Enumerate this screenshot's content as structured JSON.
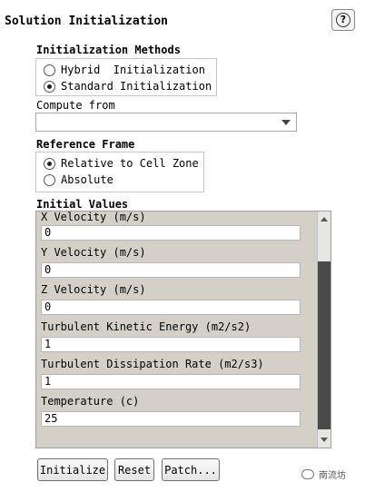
{
  "header": {
    "title": "Solution Initialization",
    "help_label": "?"
  },
  "init_methods": {
    "label": "Initialization Methods",
    "options": [
      {
        "label": "Hybrid  Initialization",
        "selected": false
      },
      {
        "label": "Standard Initialization",
        "selected": true
      }
    ]
  },
  "compute_from": {
    "label": "Compute from",
    "value": ""
  },
  "reference_frame": {
    "label": "Reference Frame",
    "options": [
      {
        "label": "Relative to Cell Zone",
        "selected": true
      },
      {
        "label": "Absolute",
        "selected": false
      }
    ]
  },
  "initial_values": {
    "label": "Initial Values",
    "fields": [
      {
        "label": "X Velocity (m/s)",
        "value": "0"
      },
      {
        "label": "Y Velocity (m/s)",
        "value": "0"
      },
      {
        "label": "Z Velocity (m/s)",
        "value": "0"
      },
      {
        "label": "Turbulent Kinetic Energy (m2/s2)",
        "value": "1"
      },
      {
        "label": "Turbulent Dissipation Rate (m2/s3)",
        "value": "1"
      },
      {
        "label": "Temperature (c)",
        "value": "25"
      }
    ]
  },
  "buttons": {
    "initialize": "Initialize",
    "reset": "Reset",
    "patch": "Patch..."
  },
  "watermark": "南流坊"
}
